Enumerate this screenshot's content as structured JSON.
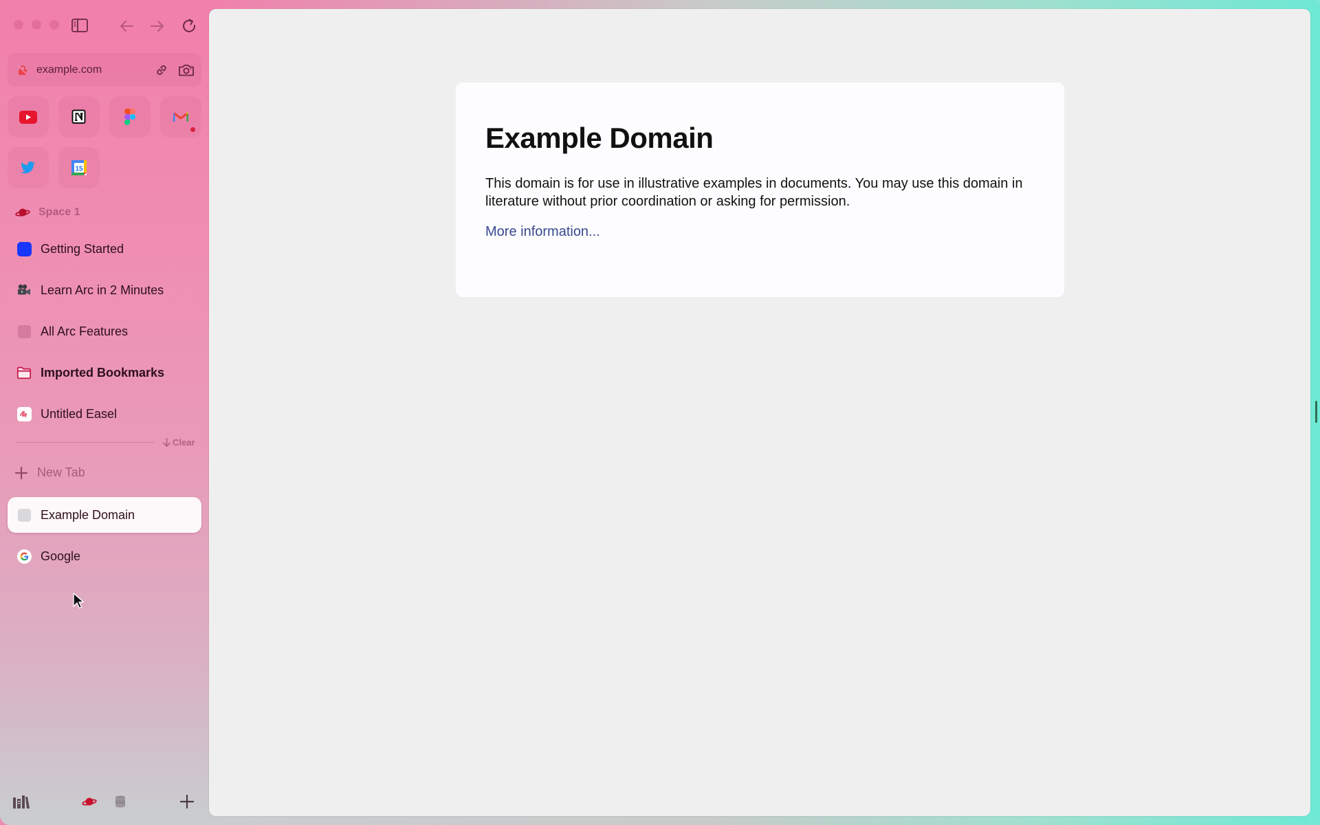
{
  "window": {
    "traffic_lights": [
      "close",
      "minimize",
      "zoom"
    ],
    "toolbar": {
      "sidebar_toggle_icon": "sidebar-icon",
      "back_icon": "arrow-left-icon",
      "forward_icon": "arrow-right-icon",
      "reload_icon": "reload-icon"
    }
  },
  "urlbar": {
    "url": "example.com",
    "security_icon": "lock-slash-icon",
    "copy_link_icon": "link-icon",
    "capture_icon": "camera-icon"
  },
  "favorites": [
    {
      "name": "YouTube",
      "icon": "youtube-icon"
    },
    {
      "name": "Notion",
      "icon": "notion-icon"
    },
    {
      "name": "Figma",
      "icon": "figma-icon"
    },
    {
      "name": "Gmail",
      "icon": "gmail-icon",
      "badge": true
    },
    {
      "name": "Twitter",
      "icon": "twitter-icon"
    },
    {
      "name": "Google Calendar",
      "icon": "calendar-icon",
      "day": "15"
    }
  ],
  "space": {
    "label": "Space 1",
    "icon": "planet-icon"
  },
  "pinned": [
    {
      "label": "Getting Started",
      "icon": "blue-square-icon"
    },
    {
      "label": "Learn Arc in 2 Minutes",
      "icon": "movie-camera-icon"
    },
    {
      "label": "All Arc Features",
      "icon": "placeholder-square-icon"
    },
    {
      "label": "Imported Bookmarks",
      "icon": "folder-icon",
      "bold": true
    },
    {
      "label": "Untitled Easel",
      "icon": "easel-icon"
    }
  ],
  "clear_label": "Clear",
  "new_tab_label": "New Tab",
  "tabs": [
    {
      "label": "Example Domain",
      "icon": "placeholder-square-icon",
      "active": true
    },
    {
      "label": "Google",
      "icon": "google-icon",
      "active": false
    }
  ],
  "bottom_bar": {
    "library_icon": "library-icon",
    "space_icon": "planet-icon",
    "archive_icon": "database-icon",
    "add_icon": "plus-icon"
  },
  "page": {
    "title": "Example Domain",
    "body": "This domain is for use in illustrative examples in documents. You may use this domain in literature without prior coordination or asking for permission.",
    "link": "More information..."
  },
  "colors": {
    "sidebar_accent": "#f07fa7",
    "space_icon": "#c0143c",
    "link": "#38488f",
    "window_edge": "#6de9d5"
  }
}
